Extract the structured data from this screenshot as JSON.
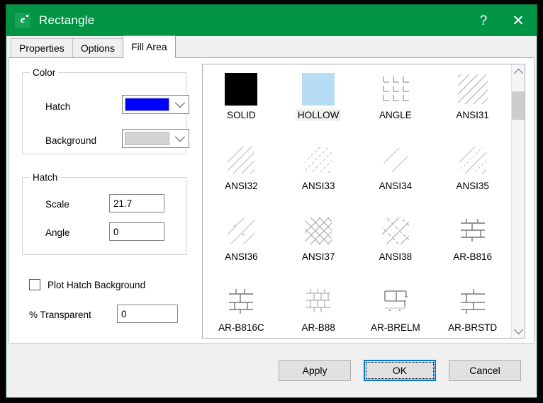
{
  "window": {
    "title": "Rectangle",
    "app_icon": "cad-app-icon",
    "icon_letter": "e",
    "titlebar_color": "#009444",
    "help_label": "?",
    "close_label": "✕"
  },
  "tabs": [
    {
      "label": "Properties",
      "active": false
    },
    {
      "label": "Options",
      "active": false
    },
    {
      "label": "Fill Area",
      "active": true
    }
  ],
  "color_group": {
    "legend": "Color",
    "hatch": {
      "label": "Hatch",
      "value_color": "#0000ff"
    },
    "background": {
      "label": "Background",
      "value_color": "#d4d4d4"
    }
  },
  "hatch_group": {
    "legend": "Hatch",
    "scale": {
      "label": "Scale",
      "value": "21.7"
    },
    "angle": {
      "label": "Angle",
      "value": "0"
    }
  },
  "plot_hatch_background": {
    "label": "Plot Hatch Background",
    "checked": false
  },
  "transparent": {
    "label": "% Transparent",
    "value": "0"
  },
  "pattern_list": {
    "selected": "HOLLOW",
    "items": [
      {
        "label": "SOLID",
        "type": "solid",
        "selected": false
      },
      {
        "label": "HOLLOW",
        "type": "hollow",
        "selected": true
      },
      {
        "label": "ANGLE",
        "type": "angle",
        "selected": false
      },
      {
        "label": "ANSI31",
        "type": "diag45",
        "selected": false
      },
      {
        "label": "ANSI32",
        "type": "diag45b",
        "selected": false
      },
      {
        "label": "ANSI33",
        "type": "diag45c",
        "selected": false
      },
      {
        "label": "ANSI34",
        "type": "diag45d",
        "selected": false
      },
      {
        "label": "ANSI35",
        "type": "diag45e",
        "selected": false
      },
      {
        "label": "ANSI36",
        "type": "diag45f",
        "selected": false
      },
      {
        "label": "ANSI37",
        "type": "cross45",
        "selected": false
      },
      {
        "label": "ANSI38",
        "type": "cross45b",
        "selected": false
      },
      {
        "label": "AR-B816",
        "type": "brick1",
        "selected": false
      },
      {
        "label": "AR-B816C",
        "type": "brick2",
        "selected": false
      },
      {
        "label": "AR-B88",
        "type": "brick3",
        "selected": false
      },
      {
        "label": "AR-BRELM",
        "type": "brick4",
        "selected": false
      },
      {
        "label": "AR-BRSTD",
        "type": "brick5",
        "selected": false
      }
    ],
    "scrollbar": {
      "up": "▲",
      "down": "▼",
      "thumb_position": "top"
    }
  },
  "footer": {
    "apply_label": "Apply",
    "ok_label": "OK",
    "cancel_label": "Cancel",
    "default_button": "OK",
    "accent_color": "#0078d7"
  }
}
